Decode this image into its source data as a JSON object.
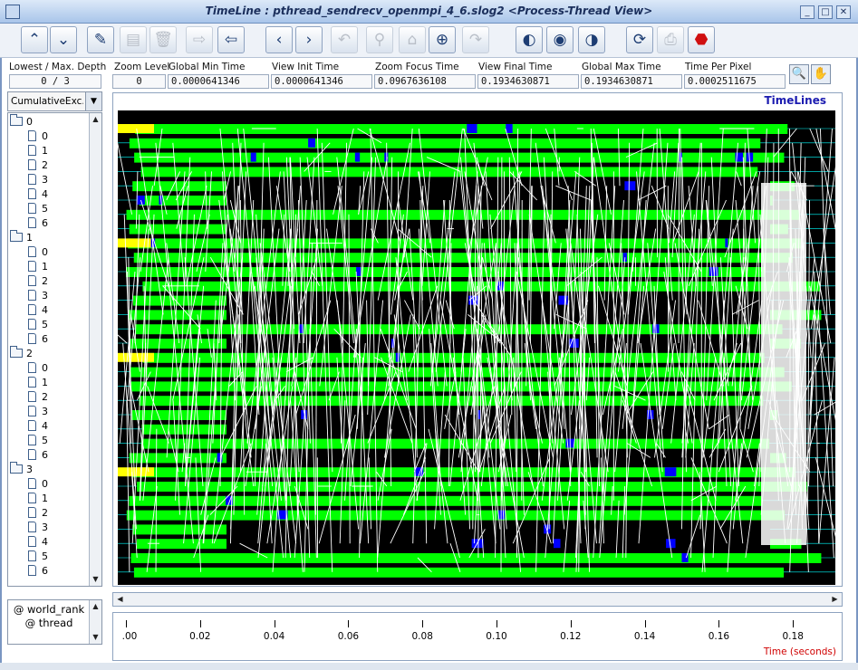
{
  "window": {
    "title": "TimeLine : pthread_sendrecv_openmpi_4_6.slog2  <Process-Thread View>",
    "buttons": [
      "_",
      "□",
      "✕"
    ]
  },
  "toolbar": [
    {
      "name": "scroll-up-button",
      "glyph": "⌃",
      "enabled": true
    },
    {
      "name": "scroll-down-button",
      "glyph": "⌄",
      "enabled": true
    },
    {
      "name": "edit-button",
      "glyph": "✎",
      "enabled": true
    },
    {
      "name": "paste-button",
      "glyph": "▤",
      "enabled": false
    },
    {
      "name": "delete-button",
      "glyph": "🗑",
      "enabled": false
    },
    {
      "name": "move-forward-button",
      "glyph": "⇨",
      "enabled": false
    },
    {
      "name": "move-back-button",
      "glyph": "⇦",
      "enabled": true
    },
    {
      "name": "scroll-left-button",
      "glyph": "‹",
      "enabled": true
    },
    {
      "name": "scroll-right-button",
      "glyph": "›",
      "enabled": true
    },
    {
      "name": "undo-zoom-button",
      "glyph": "↶",
      "enabled": false
    },
    {
      "name": "zoom-out-button",
      "glyph": "⚲",
      "enabled": false
    },
    {
      "name": "zoom-home-button",
      "glyph": "⌂",
      "enabled": false
    },
    {
      "name": "zoom-in-button",
      "glyph": "⊕",
      "enabled": true
    },
    {
      "name": "redo-zoom-button",
      "glyph": "↷",
      "enabled": false
    },
    {
      "name": "search-backward-button",
      "glyph": "◐",
      "enabled": true
    },
    {
      "name": "search-init-button",
      "glyph": "◉",
      "enabled": true
    },
    {
      "name": "search-forward-button",
      "glyph": "◑",
      "enabled": true
    },
    {
      "name": "refresh-button",
      "glyph": "⟳",
      "enabled": true
    },
    {
      "name": "print-button",
      "glyph": "⎙",
      "enabled": false
    },
    {
      "name": "stop-button",
      "glyph": "⬣",
      "enabled": true
    }
  ],
  "header": {
    "depth_label": "Lowest / Max. Depth",
    "depth_value": "0 / 3",
    "zoom_level_label": "Zoom Level",
    "zoom_level_value": "0",
    "global_min_label": "Global Min Time",
    "global_min_value": "0.0000641346",
    "view_init_label": "View  Init Time",
    "view_init_value": "0.0000641346",
    "zoom_focus_label": "Zoom Focus Time",
    "zoom_focus_value": "0.0967636108",
    "view_final_label": "View Final Time",
    "view_final_value": "0.1934630871",
    "global_max_label": "Global Max Time",
    "global_max_value": "0.1934630871",
    "time_per_pixel_label": "Time Per Pixel",
    "time_per_pixel_value": "0.0002511675"
  },
  "left_panel": {
    "combo_value": "CumulativeExc...",
    "groups": [
      {
        "label": "0",
        "threads": [
          "0",
          "1",
          "2",
          "3",
          "4",
          "5",
          "6"
        ]
      },
      {
        "label": "1",
        "threads": [
          "0",
          "1",
          "2",
          "3",
          "4",
          "5",
          "6"
        ]
      },
      {
        "label": "2",
        "threads": [
          "0",
          "1",
          "2",
          "3",
          "4",
          "5",
          "6"
        ]
      },
      {
        "label": "3",
        "threads": [
          "0",
          "1",
          "2",
          "3",
          "4",
          "5",
          "6"
        ]
      }
    ],
    "legend_line1": "@ world_rank",
    "legend_line2": "@ thread"
  },
  "timelines": {
    "title": "TimeLines",
    "colors": {
      "background": "#000000",
      "state": "#00ff00",
      "message": "#ffffff",
      "blocking": "#0000ff",
      "init": "#ffff00",
      "axis": "#00ffff"
    }
  },
  "time_axis": {
    "ticks": [
      ".00",
      "0.02",
      "0.04",
      "0.06",
      "0.08",
      "0.10",
      "0.12",
      "0.14",
      "0.16",
      "0.18"
    ],
    "title": "Time (seconds)"
  }
}
